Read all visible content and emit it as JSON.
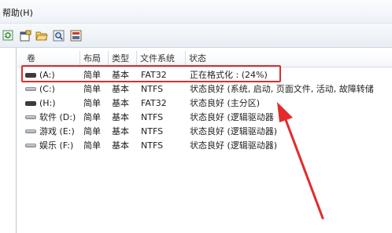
{
  "menu": {
    "help": "帮助(H)"
  },
  "toolbar": {
    "icons": [
      "refresh-icon",
      "properties-icon",
      "open-folder-icon",
      "search-disk-icon",
      "settings-icon"
    ]
  },
  "columns": [
    "卷",
    "布局",
    "类型",
    "文件系统",
    "状态"
  ],
  "rows": [
    {
      "volume": "(A:)",
      "layout": "简单",
      "type": "基本",
      "fs": "FAT32",
      "status": "正在格式化 : (24%)",
      "icon": "dark"
    },
    {
      "volume": "(C:)",
      "layout": "简单",
      "type": "基本",
      "fs": "NTFS",
      "status": "状态良好 (系统, 启动, 页面文件, 活动, 故障转储",
      "icon": "gray"
    },
    {
      "volume": "(H:)",
      "layout": "简单",
      "type": "基本",
      "fs": "FAT32",
      "status": "状态良好 (主分区)",
      "icon": "dark"
    },
    {
      "volume": "软件 (D:)",
      "layout": "简单",
      "type": "基本",
      "fs": "NTFS",
      "status": "状态良好 (逻辑驱动器",
      "icon": "gray"
    },
    {
      "volume": "游戏 (E:)",
      "layout": "简单",
      "type": "基本",
      "fs": "NTFS",
      "status": "状态良好 (逻辑驱动器)",
      "icon": "gray"
    },
    {
      "volume": "娱乐 (F:)",
      "layout": "简单",
      "type": "基本",
      "fs": "NTFS",
      "status": "状态良好 (逻辑驱动器)",
      "icon": "gray"
    }
  ],
  "annotation_color": "#e32b2b"
}
